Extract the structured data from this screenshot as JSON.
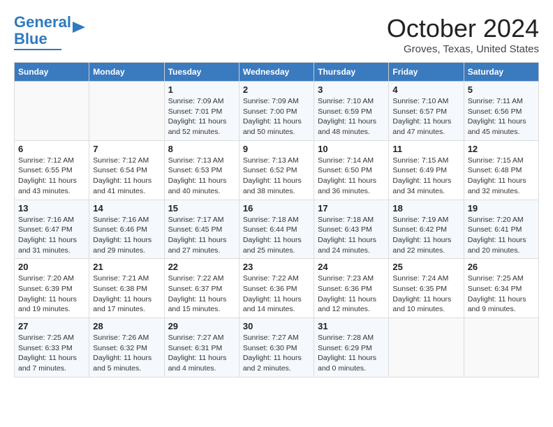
{
  "header": {
    "logo_line1": "General",
    "logo_line2": "Blue",
    "month": "October 2024",
    "location": "Groves, Texas, United States"
  },
  "days_of_week": [
    "Sunday",
    "Monday",
    "Tuesday",
    "Wednesday",
    "Thursday",
    "Friday",
    "Saturday"
  ],
  "weeks": [
    [
      {
        "day": "",
        "info": ""
      },
      {
        "day": "",
        "info": ""
      },
      {
        "day": "1",
        "info": "Sunrise: 7:09 AM\nSunset: 7:01 PM\nDaylight: 11 hours and 52 minutes."
      },
      {
        "day": "2",
        "info": "Sunrise: 7:09 AM\nSunset: 7:00 PM\nDaylight: 11 hours and 50 minutes."
      },
      {
        "day": "3",
        "info": "Sunrise: 7:10 AM\nSunset: 6:59 PM\nDaylight: 11 hours and 48 minutes."
      },
      {
        "day": "4",
        "info": "Sunrise: 7:10 AM\nSunset: 6:57 PM\nDaylight: 11 hours and 47 minutes."
      },
      {
        "day": "5",
        "info": "Sunrise: 7:11 AM\nSunset: 6:56 PM\nDaylight: 11 hours and 45 minutes."
      }
    ],
    [
      {
        "day": "6",
        "info": "Sunrise: 7:12 AM\nSunset: 6:55 PM\nDaylight: 11 hours and 43 minutes."
      },
      {
        "day": "7",
        "info": "Sunrise: 7:12 AM\nSunset: 6:54 PM\nDaylight: 11 hours and 41 minutes."
      },
      {
        "day": "8",
        "info": "Sunrise: 7:13 AM\nSunset: 6:53 PM\nDaylight: 11 hours and 40 minutes."
      },
      {
        "day": "9",
        "info": "Sunrise: 7:13 AM\nSunset: 6:52 PM\nDaylight: 11 hours and 38 minutes."
      },
      {
        "day": "10",
        "info": "Sunrise: 7:14 AM\nSunset: 6:50 PM\nDaylight: 11 hours and 36 minutes."
      },
      {
        "day": "11",
        "info": "Sunrise: 7:15 AM\nSunset: 6:49 PM\nDaylight: 11 hours and 34 minutes."
      },
      {
        "day": "12",
        "info": "Sunrise: 7:15 AM\nSunset: 6:48 PM\nDaylight: 11 hours and 32 minutes."
      }
    ],
    [
      {
        "day": "13",
        "info": "Sunrise: 7:16 AM\nSunset: 6:47 PM\nDaylight: 11 hours and 31 minutes."
      },
      {
        "day": "14",
        "info": "Sunrise: 7:16 AM\nSunset: 6:46 PM\nDaylight: 11 hours and 29 minutes."
      },
      {
        "day": "15",
        "info": "Sunrise: 7:17 AM\nSunset: 6:45 PM\nDaylight: 11 hours and 27 minutes."
      },
      {
        "day": "16",
        "info": "Sunrise: 7:18 AM\nSunset: 6:44 PM\nDaylight: 11 hours and 25 minutes."
      },
      {
        "day": "17",
        "info": "Sunrise: 7:18 AM\nSunset: 6:43 PM\nDaylight: 11 hours and 24 minutes."
      },
      {
        "day": "18",
        "info": "Sunrise: 7:19 AM\nSunset: 6:42 PM\nDaylight: 11 hours and 22 minutes."
      },
      {
        "day": "19",
        "info": "Sunrise: 7:20 AM\nSunset: 6:41 PM\nDaylight: 11 hours and 20 minutes."
      }
    ],
    [
      {
        "day": "20",
        "info": "Sunrise: 7:20 AM\nSunset: 6:39 PM\nDaylight: 11 hours and 19 minutes."
      },
      {
        "day": "21",
        "info": "Sunrise: 7:21 AM\nSunset: 6:38 PM\nDaylight: 11 hours and 17 minutes."
      },
      {
        "day": "22",
        "info": "Sunrise: 7:22 AM\nSunset: 6:37 PM\nDaylight: 11 hours and 15 minutes."
      },
      {
        "day": "23",
        "info": "Sunrise: 7:22 AM\nSunset: 6:36 PM\nDaylight: 11 hours and 14 minutes."
      },
      {
        "day": "24",
        "info": "Sunrise: 7:23 AM\nSunset: 6:36 PM\nDaylight: 11 hours and 12 minutes."
      },
      {
        "day": "25",
        "info": "Sunrise: 7:24 AM\nSunset: 6:35 PM\nDaylight: 11 hours and 10 minutes."
      },
      {
        "day": "26",
        "info": "Sunrise: 7:25 AM\nSunset: 6:34 PM\nDaylight: 11 hours and 9 minutes."
      }
    ],
    [
      {
        "day": "27",
        "info": "Sunrise: 7:25 AM\nSunset: 6:33 PM\nDaylight: 11 hours and 7 minutes."
      },
      {
        "day": "28",
        "info": "Sunrise: 7:26 AM\nSunset: 6:32 PM\nDaylight: 11 hours and 5 minutes."
      },
      {
        "day": "29",
        "info": "Sunrise: 7:27 AM\nSunset: 6:31 PM\nDaylight: 11 hours and 4 minutes."
      },
      {
        "day": "30",
        "info": "Sunrise: 7:27 AM\nSunset: 6:30 PM\nDaylight: 11 hours and 2 minutes."
      },
      {
        "day": "31",
        "info": "Sunrise: 7:28 AM\nSunset: 6:29 PM\nDaylight: 11 hours and 0 minutes."
      },
      {
        "day": "",
        "info": ""
      },
      {
        "day": "",
        "info": ""
      }
    ]
  ]
}
